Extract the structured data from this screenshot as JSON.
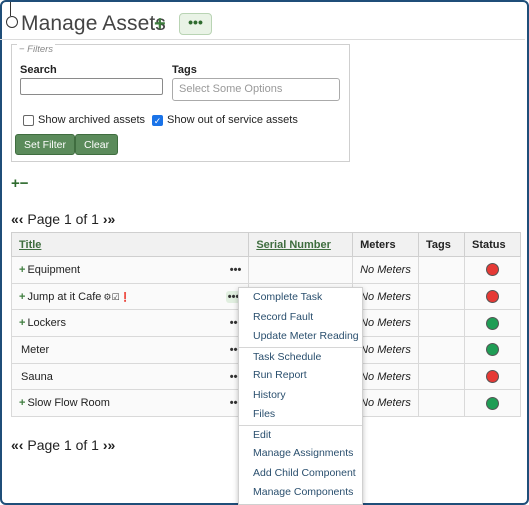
{
  "page": {
    "title": "Manage Assets",
    "add_symbol": "+",
    "more_symbol": "•••"
  },
  "filters": {
    "legend": "− Filters",
    "search_label": "Search",
    "search_value": "",
    "tags_label": "Tags",
    "tags_placeholder": "Select Some Options",
    "show_archived": {
      "label": "Show archived assets",
      "checked": false
    },
    "show_out_of_service": {
      "label": "Show out of service assets",
      "checked": true
    },
    "set_filter": "Set Filter",
    "clear": "Clear"
  },
  "tree_controls": {
    "expand": "+",
    "collapse": "−"
  },
  "pager": {
    "first": "«",
    "prev": "‹",
    "text": "Page 1 of 1",
    "next": "›",
    "last": "»"
  },
  "table": {
    "headers": {
      "title": "Title",
      "serial": "Serial Number",
      "meters": "Meters",
      "tags": "Tags",
      "status": "Status"
    },
    "rows": [
      {
        "expand": "+",
        "title": "Equipment",
        "menu": "•••",
        "serial": "",
        "meters": "No Meters",
        "tags": "",
        "status": "red"
      },
      {
        "expand": "+",
        "title": "Jump at it Cafe",
        "icons": "⚙☑❗",
        "menu": "•••",
        "serial": "",
        "meters": "No Meters",
        "tags": "",
        "status": "red"
      },
      {
        "expand": "+",
        "title": "Lockers",
        "menu": "•••",
        "serial": "",
        "meters": "No Meters",
        "tags": "",
        "status": "green"
      },
      {
        "expand": "",
        "title": "Meter",
        "menu": "•••",
        "serial": "",
        "meters": "No Meters",
        "tags": "",
        "status": "green"
      },
      {
        "expand": "",
        "title": "Sauna",
        "menu": "•••",
        "serial": "",
        "meters": "No Meters",
        "tags": "",
        "status": "red"
      },
      {
        "expand": "+",
        "title": "Slow Flow Room",
        "menu": "•••",
        "serial": "",
        "meters": "No Meters",
        "tags": "",
        "status": "green"
      }
    ]
  },
  "context_menu": {
    "groups": [
      [
        "Complete Task",
        "Record Fault",
        "Update Meter Reading"
      ],
      [
        "Task Schedule",
        "Run Report",
        "History",
        "Files"
      ],
      [
        "Edit",
        "Manage Assignments",
        "Add Child Component",
        "Manage Components"
      ]
    ]
  },
  "colors": {
    "accent_green": "#5b8b5b",
    "status_red": "#e53935",
    "status_green": "#1f9d55",
    "frame_blue": "#1f4e79"
  }
}
